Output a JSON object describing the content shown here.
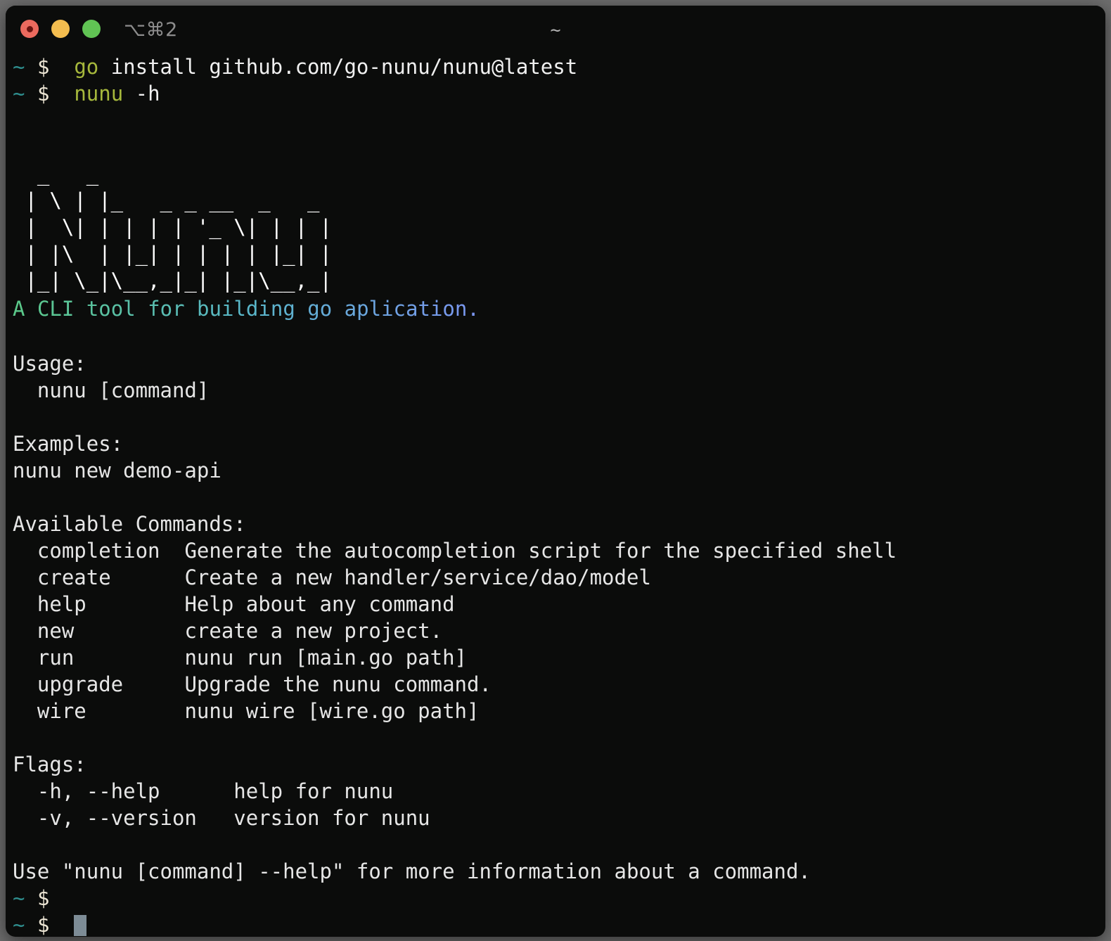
{
  "window": {
    "title": "~",
    "shortcut": "⌥⌘2",
    "traffic_lights": [
      {
        "name": "close",
        "color": "#ec6a5e"
      },
      {
        "name": "minimize",
        "color": "#f4bd4f"
      },
      {
        "name": "maximize",
        "color": "#61c454"
      }
    ]
  },
  "colors": {
    "background": "#0b0c0b",
    "foreground": "#e6e6e6",
    "prompt_tilde": "#2f8f8f",
    "prompt_dollar": "#ece5d4",
    "command_name": "#a6b83c",
    "cursor": "#7d8c96",
    "gradient_start": "#5bc98a",
    "gradient_mid": "#59b7c9",
    "gradient_end": "#7b96f0"
  },
  "prompt": {
    "tilde": "~",
    "dollar": "$"
  },
  "commands_entered": [
    {
      "name": "go",
      "args": " install github.com/go-nunu/nunu@latest"
    },
    {
      "name": "nunu",
      "args": " -h"
    }
  ],
  "banner": {
    "lines": [
      "  _   _                    ",
      " | \\ | |_   _ _ __  _   _ ",
      " |  \\| | | | | '_ \\| | | |",
      " | |\\  | |_| | | | | |_| |",
      " |_| \\_|\\__,_|_| |_|\\__,_|"
    ]
  },
  "description": "A CLI tool for building go aplication.",
  "usage": {
    "heading": "Usage:",
    "line": "  nunu [command]"
  },
  "examples": {
    "heading": "Examples:",
    "line": "nunu new demo-api"
  },
  "available_commands": {
    "heading": "Available Commands:",
    "items": [
      {
        "name": "completion",
        "description": "Generate the autocompletion script for the specified shell"
      },
      {
        "name": "create",
        "description": "Create a new handler/service/dao/model"
      },
      {
        "name": "help",
        "description": "Help about any command"
      },
      {
        "name": "new",
        "description": "create a new project."
      },
      {
        "name": "run",
        "description": "nunu run [main.go path]"
      },
      {
        "name": "upgrade",
        "description": "Upgrade the nunu command."
      },
      {
        "name": "wire",
        "description": "nunu wire [wire.go path]"
      }
    ]
  },
  "flags": {
    "heading": "Flags:",
    "items": [
      {
        "flag": "-h, --help",
        "description": "help for nunu"
      },
      {
        "flag": "-v, --version",
        "description": "version for nunu"
      }
    ]
  },
  "footer": "Use \"nunu [command] --help\" for more information about a command."
}
